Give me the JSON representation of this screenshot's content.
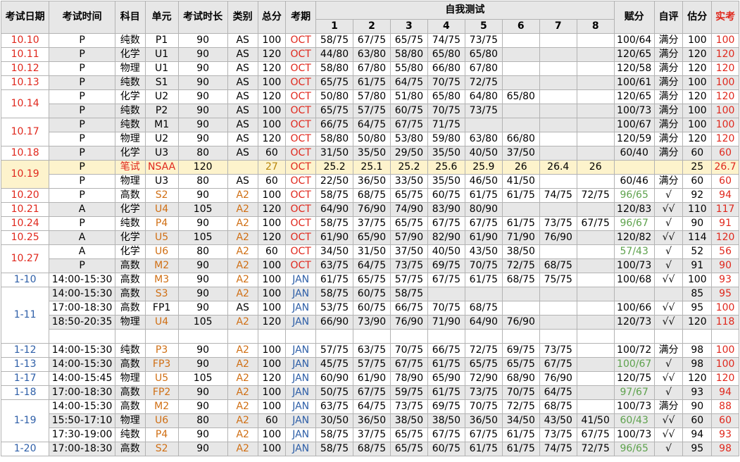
{
  "headers": {
    "date": "考试日期",
    "time": "考试时间",
    "subject": "科目",
    "unit": "单元",
    "duration": "考试时长",
    "category": "类别",
    "total": "总分",
    "session": "考期",
    "selftest": "自我测试",
    "nums": [
      "1",
      "2",
      "3",
      "4",
      "5",
      "6",
      "7",
      "8"
    ],
    "award": "赋分",
    "selfeval": "自评",
    "estimate": "估分",
    "actual": "实考"
  },
  "colors": {
    "red": "#e0281d",
    "blue": "#2e5fa8",
    "orange": "#d06f14",
    "green": "#5ea24d",
    "highlight": "#fdf3cc",
    "gray": "#e7e7e7"
  },
  "rows": [
    {
      "date": "10.10",
      "span": 1,
      "time": "P",
      "subj": "纯数",
      "unit": "P1",
      "dur": "90",
      "cat": "AS",
      "tot": "100",
      "ses": "OCT",
      "t": [
        "58/75",
        "67/75",
        "65/75",
        "74/75",
        "73/75",
        "",
        "",
        ""
      ],
      "aw": "100/64",
      "se": "满分",
      "est": "100",
      "act": "100",
      "g": 0
    },
    {
      "date": "10.11",
      "span": 1,
      "time": "P",
      "subj": "化学",
      "unit": "U1",
      "dur": "90",
      "cat": "AS",
      "tot": "120",
      "ses": "OCT",
      "t": [
        "44/80",
        "63/80",
        "58/80",
        "65/80",
        "65/80",
        "",
        "",
        ""
      ],
      "aw": "120/65",
      "se": "满分",
      "est": "120",
      "act": "120",
      "g": 1
    },
    {
      "date": "10.12",
      "span": 1,
      "time": "P",
      "subj": "物理",
      "unit": "U1",
      "dur": "90",
      "cat": "AS",
      "tot": "120",
      "ses": "OCT",
      "t": [
        "58/80",
        "67/80",
        "55/80",
        "66/80",
        "67/80",
        "",
        "",
        ""
      ],
      "aw": "120/58",
      "se": "满分",
      "est": "120",
      "act": "120",
      "g": 0
    },
    {
      "date": "10.13",
      "span": 1,
      "time": "P",
      "subj": "纯数",
      "unit": "S1",
      "dur": "90",
      "cat": "AS",
      "tot": "100",
      "ses": "OCT",
      "t": [
        "65/75",
        "61/75",
        "64/75",
        "70/75",
        "72/75",
        "",
        "",
        ""
      ],
      "aw": "100/61",
      "se": "满分",
      "est": "100",
      "act": "100",
      "g": 1
    },
    {
      "date": "10.14",
      "span": 2,
      "time": "P",
      "subj": "化学",
      "unit": "U2",
      "dur": "90",
      "cat": "AS",
      "tot": "120",
      "ses": "OCT",
      "t": [
        "50/80",
        "57/80",
        "51/80",
        "65/80",
        "64/80",
        "65/80",
        "",
        ""
      ],
      "aw": "120/65",
      "se": "满分",
      "est": "120",
      "act": "120",
      "g": 0
    },
    {
      "time": "P",
      "subj": "纯数",
      "unit": "P2",
      "dur": "90",
      "cat": "AS",
      "tot": "100",
      "ses": "OCT",
      "t": [
        "65/75",
        "57/75",
        "60/75",
        "70/75",
        "73/75",
        "",
        "",
        ""
      ],
      "aw": "100/73",
      "se": "满分",
      "est": "100",
      "act": "100",
      "g": 1
    },
    {
      "date": "10.17",
      "span": 2,
      "time": "P",
      "subj": "纯数",
      "unit": "M1",
      "dur": "90",
      "cat": "AS",
      "tot": "100",
      "ses": "OCT",
      "t": [
        "66/75",
        "64/75",
        "67/75",
        "71/75",
        "",
        "",
        "",
        ""
      ],
      "aw": "100/67",
      "se": "满分",
      "est": "100",
      "act": "100",
      "g": 1
    },
    {
      "time": "P",
      "subj": "物理",
      "unit": "U2",
      "dur": "90",
      "cat": "AS",
      "tot": "120",
      "ses": "OCT",
      "t": [
        "58/80",
        "50/80",
        "53/80",
        "59/80",
        "63/80",
        "66/80",
        "",
        ""
      ],
      "aw": "120/59",
      "se": "满分",
      "est": "120",
      "act": "120",
      "g": 0
    },
    {
      "date": "10.18",
      "span": 1,
      "time": "P",
      "subj": "化学",
      "unit": "U3",
      "dur": "80",
      "cat": "AS",
      "tot": "60",
      "ses": "OCT",
      "t": [
        "31/50",
        "35/50",
        "29/50",
        "35/50",
        "40/50",
        "37/50",
        "",
        ""
      ],
      "aw": "60/40",
      "se": "满分",
      "est": "60",
      "act": "60",
      "g": 1
    },
    {
      "date": "10.19",
      "span": 2,
      "time": "P",
      "subj": "笔试",
      "unit": "NSAA",
      "dur": "120",
      "cat": "",
      "tot": "27",
      "ses": "OCT",
      "t": [
        "25.2",
        "25.1",
        "25.2",
        "25.6",
        "25.9",
        "26",
        "26.4",
        "26"
      ],
      "aw": "",
      "se": "",
      "est": "25",
      "act": "26.7",
      "hl": 1
    },
    {
      "time": "P",
      "subj": "物理",
      "unit": "U3",
      "dur": "80",
      "cat": "AS",
      "tot": "60",
      "ses": "OCT",
      "t": [
        "22/50",
        "36/50",
        "33/50",
        "35/50",
        "46/50",
        "41/50",
        "",
        ""
      ],
      "aw": "60/46",
      "se": "满分",
      "est": "60",
      "act": "60",
      "g": 0
    },
    {
      "date": "10.20",
      "span": 1,
      "time": "P",
      "subj": "高数",
      "unit": "S2",
      "dur": "90",
      "cat": "A2",
      "tot": "100",
      "ses": "OCT",
      "t": [
        "58/75",
        "68/75",
        "65/75",
        "60/75",
        "61/75",
        "61/75",
        "74/75",
        "72/75"
      ],
      "aw": "96/65",
      "awc": "green",
      "se": "√",
      "est": "92",
      "act": "94",
      "g": 0
    },
    {
      "date": "10.21",
      "span": 1,
      "time": "A",
      "subj": "化学",
      "unit": "U4",
      "dur": "105",
      "cat": "A2",
      "tot": "120",
      "ses": "OCT",
      "t": [
        "64/90",
        "76/90",
        "74/90",
        "83/90",
        "80/90",
        "",
        "",
        ""
      ],
      "aw": "120/83",
      "se": "√√",
      "est": "110",
      "act": "117",
      "g": 1
    },
    {
      "date": "10.24",
      "span": 1,
      "time": "P",
      "subj": "纯数",
      "unit": "P4",
      "dur": "90",
      "cat": "A2",
      "tot": "100",
      "ses": "OCT",
      "t": [
        "58/75",
        "37/75",
        "65/75",
        "67/75",
        "67/75",
        "61/75",
        "73/75",
        "67/75"
      ],
      "aw": "96/67",
      "awc": "green",
      "se": "√",
      "est": "90",
      "act": "91",
      "g": 0
    },
    {
      "date": "10.25",
      "span": 1,
      "time": "A",
      "subj": "化学",
      "unit": "U5",
      "dur": "105",
      "cat": "A2",
      "tot": "120",
      "ses": "OCT",
      "t": [
        "61/90",
        "65/90",
        "57/90",
        "82/90",
        "61/90",
        "71/90",
        "76/90",
        ""
      ],
      "aw": "120/82",
      "se": "√√",
      "est": "114",
      "act": "120",
      "g": 1
    },
    {
      "date": "10.27",
      "span": 2,
      "time": "A",
      "subj": "化学",
      "unit": "U6",
      "dur": "80",
      "cat": "A2",
      "tot": "60",
      "ses": "OCT",
      "t": [
        "34/50",
        "31/50",
        "37/50",
        "40/50",
        "43/50",
        "38/50",
        "",
        ""
      ],
      "aw": "57/43",
      "awc": "green",
      "se": "√",
      "est": "52",
      "act": "56",
      "g": 0
    },
    {
      "time": "P",
      "subj": "高数",
      "unit": "M2",
      "dur": "90",
      "cat": "A2",
      "tot": "100",
      "ses": "OCT",
      "t": [
        "63/75",
        "64/75",
        "73/75",
        "69/75",
        "70/75",
        "72/75",
        "68/75",
        ""
      ],
      "aw": "100/73",
      "se": "√",
      "est": "91",
      "act": "90",
      "g": 1
    },
    {
      "date": "1-10",
      "span": 1,
      "db": 1,
      "time": "14:00-15:30",
      "subj": "高数",
      "unit": "M3",
      "dur": "90",
      "cat": "A2",
      "tot": "100",
      "ses": "JAN",
      "t": [
        "61/75",
        "65/75",
        "57/75",
        "67/75",
        "61/75",
        "68/75",
        "75/75",
        ""
      ],
      "aw": "100/68",
      "se": "√√",
      "est": "100",
      "act": "93",
      "g": 0
    },
    {
      "date": "1-11",
      "span": 4,
      "db": 1,
      "time": "14:00-15:30",
      "subj": "高数",
      "unit": "S3",
      "dur": "90",
      "cat": "A2",
      "tot": "100",
      "ses": "JAN",
      "t": [
        "58/75",
        "60/75",
        "58/75",
        "",
        "",
        "",
        "",
        ""
      ],
      "aw": "",
      "se": "",
      "est": "85",
      "act": "95",
      "g": 1
    },
    {
      "time": "17:00-18:30",
      "subj": "高数",
      "unit": "FP1",
      "dur": "90",
      "cat": "AS",
      "tot": "100",
      "ses": "JAN",
      "t": [
        "53/75",
        "60/75",
        "66/75",
        "70/75",
        "68/75",
        "",
        "",
        ""
      ],
      "aw": "100/66",
      "se": "√√",
      "est": "95",
      "act": "100",
      "g": 0
    },
    {
      "time": "18:50-20:35",
      "subj": "物理",
      "unit": "U4",
      "dur": "105",
      "cat": "A2",
      "tot": "120",
      "ses": "JAN",
      "t": [
        "66/90",
        "73/90",
        "76/90",
        "71/90",
        "64/90",
        "76/90",
        "",
        ""
      ],
      "aw": "120/73",
      "se": "√√",
      "est": "120",
      "act": "118",
      "g": 1
    },
    {
      "blank": 1
    },
    {
      "date": "1-12",
      "span": 1,
      "db": 1,
      "time": "14:00-15:30",
      "subj": "纯数",
      "unit": "P3",
      "dur": "90",
      "cat": "A2",
      "tot": "100",
      "ses": "JAN",
      "t": [
        "57/75",
        "63/75",
        "70/75",
        "66/75",
        "72/75",
        "69/75",
        "73/75",
        ""
      ],
      "aw": "100/72",
      "se": "满分",
      "est": "98",
      "act": "100",
      "g": 0
    },
    {
      "date": "1-13",
      "span": 1,
      "db": 1,
      "time": "14:00-15:30",
      "subj": "高数",
      "unit": "FP3",
      "dur": "90",
      "cat": "A2",
      "tot": "100",
      "ses": "JAN",
      "t": [
        "45/75",
        "57/75",
        "67/75",
        "61/75",
        "65/75",
        "65/75",
        "67/75",
        ""
      ],
      "aw": "100/67",
      "awc": "green",
      "se": "√",
      "est": "98",
      "act": "100",
      "g": 1
    },
    {
      "date": "1-17",
      "span": 1,
      "db": 1,
      "time": "14:00-15:45",
      "subj": "物理",
      "unit": "U5",
      "dur": "105",
      "cat": "A2",
      "tot": "120",
      "ses": "JAN",
      "t": [
        "60/90",
        "61/90",
        "78/90",
        "65/90",
        "72/90",
        "68/90",
        "76/90",
        ""
      ],
      "aw": "120/75",
      "se": "√√",
      "est": "120",
      "act": "120",
      "g": 0
    },
    {
      "date": "1-18",
      "span": 1,
      "db": 1,
      "time": "17:00-18:30",
      "subj": "高数",
      "unit": "FP2",
      "dur": "90",
      "cat": "A2",
      "tot": "100",
      "ses": "JAN",
      "t": [
        "50/75",
        "67/75",
        "59/75",
        "61/75",
        "73/75",
        "70/75",
        "64/75",
        ""
      ],
      "aw": "97/67",
      "awc": "green",
      "se": "√",
      "est": "93",
      "act": "94",
      "g": 1
    },
    {
      "date": "1-19",
      "span": 3,
      "db": 1,
      "time": "14:00-15:30",
      "subj": "高数",
      "unit": "M2",
      "dur": "90",
      "cat": "A2",
      "tot": "100",
      "ses": "JAN",
      "t": [
        "63/75",
        "64/75",
        "73/75",
        "69/75",
        "70/75",
        "72/75",
        "68/75",
        ""
      ],
      "aw": "100/73",
      "se": "满分",
      "est": "90",
      "act": "88",
      "g": 0
    },
    {
      "time": "15:50-17:10",
      "subj": "物理",
      "unit": "U6",
      "dur": "80",
      "cat": "A2",
      "tot": "60",
      "ses": "JAN",
      "t": [
        "30/50",
        "36/50",
        "38/50",
        "38/50",
        "36/50",
        "34/50",
        "43/50",
        "41/50"
      ],
      "aw": "60/43",
      "awc": "green",
      "se": "√√",
      "est": "60",
      "act": "60",
      "g": 1
    },
    {
      "time": "17:30-19:00",
      "subj": "纯数",
      "unit": "P4",
      "dur": "90",
      "cat": "A2",
      "tot": "100",
      "ses": "JAN",
      "t": [
        "58/75",
        "37/75",
        "65/75",
        "67/75",
        "67/75",
        "61/75",
        "73/75",
        "67/75"
      ],
      "aw": "100/73",
      "se": "√√",
      "est": "94",
      "act": "93",
      "g": 0
    },
    {
      "date": "1-20",
      "span": 1,
      "db": 1,
      "time": "17:00-18:30",
      "subj": "高数",
      "unit": "S2",
      "dur": "90",
      "cat": "A2",
      "tot": "100",
      "ses": "JAN",
      "t": [
        "58/75",
        "68/75",
        "65/75",
        "60/75",
        "61/75",
        "61/75",
        "74/75",
        "72/75"
      ],
      "aw": "96/65",
      "awc": "green",
      "se": "√",
      "est": "95",
      "act": "98",
      "g": 1
    }
  ]
}
